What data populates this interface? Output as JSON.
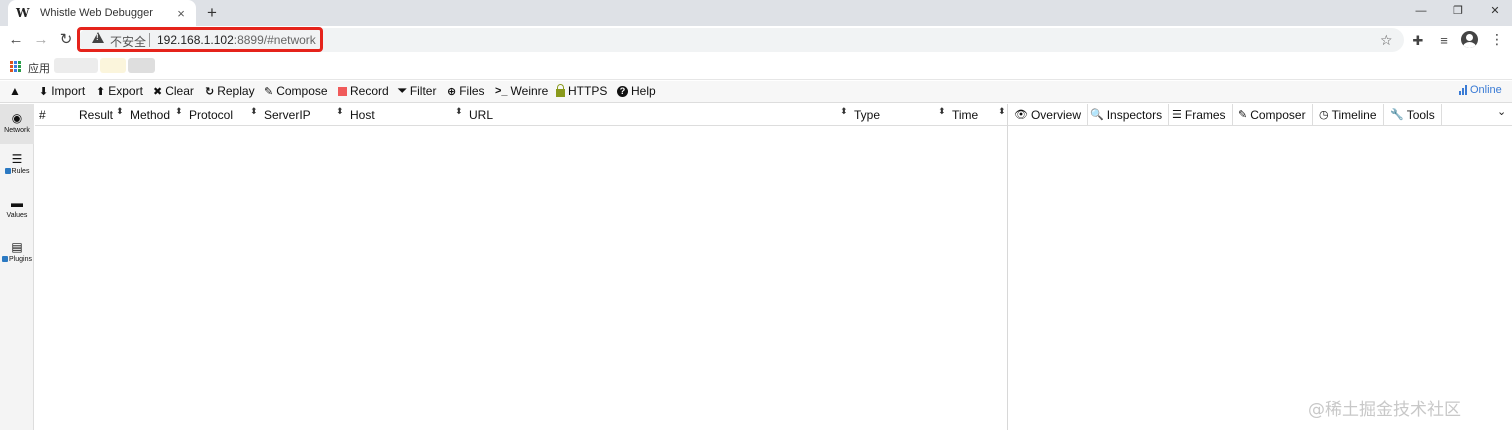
{
  "browser": {
    "tab_title": "Whistle Web Debugger",
    "tab_favicon": "W",
    "tab_close": "×",
    "new_tab": "+",
    "window_controls": {
      "minimize": "—",
      "restore": "❐",
      "close": "✕"
    },
    "nav": {
      "back": "←",
      "forward": "→",
      "reload": "↻"
    },
    "address": {
      "security_label": "不安全",
      "url_host": "192.168.1.102",
      "url_rest": ":8899/#network",
      "star": "☆"
    },
    "extensions": {
      "puzzle": "✚",
      "media": "≡",
      "menu": "⋮"
    },
    "bookmarks": {
      "apps_label": "应用"
    }
  },
  "whistle": {
    "collapse": "▲",
    "menu": [
      {
        "icon": "⬇",
        "label": "Import"
      },
      {
        "icon": "⬆",
        "label": "Export"
      },
      {
        "icon": "✖",
        "label": "Clear"
      },
      {
        "icon": "↻",
        "label": "Replay"
      },
      {
        "icon": "✎",
        "label": "Compose"
      },
      {
        "icon": "record",
        "label": "Record"
      },
      {
        "icon": "⏷",
        "label": "Filter"
      },
      {
        "icon": "⊕",
        "label": "Files"
      },
      {
        "icon": ">_",
        "label": "Weinre"
      },
      {
        "icon": "lock",
        "label": "HTTPS"
      },
      {
        "icon": "?",
        "label": "Help"
      }
    ],
    "online_label": "Online",
    "sidebar": [
      {
        "icon": "globe-icon",
        "glyph": "◉",
        "label": "Network",
        "checked": false,
        "active": true
      },
      {
        "icon": "list-icon",
        "glyph": "☰",
        "label": "Rules",
        "checked": true,
        "active": false
      },
      {
        "icon": "folder-icon",
        "glyph": "▬",
        "label": "Values",
        "checked": false,
        "active": false
      },
      {
        "icon": "plugin-icon",
        "glyph": "▤",
        "label": "Plugins",
        "checked": true,
        "active": false
      }
    ],
    "columns": [
      "#",
      "Result",
      "Method",
      "Protocol",
      "ServerIP",
      "Host",
      "URL",
      "Type",
      "Time"
    ],
    "sort_glyph": "⬍",
    "detail_tabs": [
      {
        "icon": "👁",
        "label": "Overview"
      },
      {
        "icon": "🔍",
        "label": "Inspectors"
      },
      {
        "icon": "☰",
        "label": "Frames"
      },
      {
        "icon": "✎",
        "label": "Composer"
      },
      {
        "icon": "◷",
        "label": "Timeline"
      },
      {
        "icon": "🔧",
        "label": "Tools"
      }
    ],
    "detail_more": "⌄"
  },
  "watermark": "@稀土掘金技术社区"
}
